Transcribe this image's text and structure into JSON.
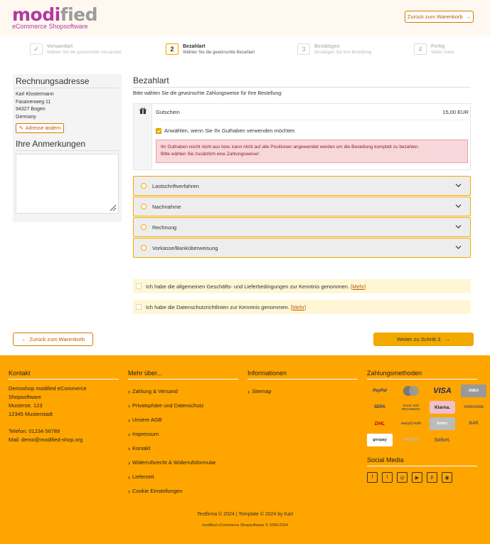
{
  "header": {
    "logo_main_a": "modi",
    "logo_main_b": "fied",
    "logo_sub": "eCommerce Shopsoftware",
    "back_to_cart": "Zurück zum Warenkorb"
  },
  "steps": [
    {
      "num": "",
      "title": "Versandart",
      "desc": "Wählen Sie die gewünschte Versandart"
    },
    {
      "num": "2",
      "title": "Bezahlart",
      "desc": "Wählen Sie die gewünschte Bezahlart"
    },
    {
      "num": "3",
      "title": "Bestätigen",
      "desc": "Bestätigen Sie Ihre Bestellung"
    },
    {
      "num": "4",
      "title": "Fertig",
      "desc": "Vielen Dank"
    }
  ],
  "billing": {
    "title": "Rechnungsadresse",
    "name": "Karl Klostermann",
    "street": "Fasanenweg 11",
    "city": "94327 Bogen",
    "country": "Germany",
    "change_button": "Adresse ändern"
  },
  "notes": {
    "title": "Ihre Anmerkungen",
    "value": ""
  },
  "payment": {
    "title": "Bezahlart",
    "subtitle": "Bitte wählen Sie die gewünschte Zahlungsweise für Ihre Bestellung:",
    "voucher_label": "Gutschein",
    "voucher_amount": "15,00 EUR",
    "voucher_check": "Anwählen, wenn Sie Ihr Guthaben verwenden möchten",
    "alert_line1": "Ihr Guthaben reicht nicht aus bzw. kann nicht auf alle Positionen angewendet werden um die Bestellung komplett zu bezahlen.",
    "alert_line2": "Bitte wählen Sie zusätzlich eine Zahlungsweise!",
    "methods": [
      "Lastschriftverfahren",
      "Nachnahme",
      "Rechnung",
      "Vorkasse/Banküberweisung"
    ]
  },
  "agreements": [
    {
      "text": "Ich habe die allgemeinen Geschäfts- und Lieferbedingungen zur Kenntnis genommen.",
      "more": "[Mehr]"
    },
    {
      "text": "Ich habe die Datenschutzrichtlinien zur Kenntnis genommen.",
      "more": "[Mehr]"
    }
  ],
  "nav": {
    "back": "Zurück zum Warenkorb",
    "next": "Weiter zu Schritt 3"
  },
  "footer": {
    "contact_title": "Kontakt",
    "contact_lines": [
      "Demoshop modified eCommerce",
      "Shopsoftware",
      "Musterstr. 123",
      "12345 Musterstadt",
      "",
      "Telefon: 01234 56789",
      "Mail: demo@modified-shop.org"
    ],
    "more_title": "Mehr über...",
    "more_links": [
      "Zahlung & Versand",
      "Privatsphäre und Datenschutz",
      "Unsere AGB",
      "Impressum",
      "Kontakt",
      "Widerrufsrecht & Widerrufsformular",
      "Lieferzeit",
      "Cookie Einstellungen"
    ],
    "info_title": "Informationen",
    "info_links": [
      "Sitemap"
    ],
    "payment_title": "Zahlungsmethoden",
    "payment_logos": [
      "PayPal",
      "mastercard",
      "VISA",
      "AMEX",
      "SEPA",
      "KAUF AUF RECHNUNG",
      "Klarna.",
      "VORKASSE",
      "DHL",
      "easyCredit",
      "Sofort.",
      "BAR",
      "giropay",
      "PAYONE",
      "Sofort."
    ],
    "social_title": "Social Media",
    "social_icons": [
      "facebook-icon",
      "twitter-icon",
      "instagram-icon",
      "youtube-icon",
      "pinterest-icon",
      "rss-icon"
    ],
    "copyright": "Testfirma © 2024 | Template © 2024 by Karl",
    "copyright2": "modified eCommerce Shopsoftware © 2009-2024"
  },
  "colors": {
    "accent": "#f2a900",
    "footer_bg": "#ffa500",
    "brand": "#b23aa0",
    "alert_bg": "#f8d7da"
  }
}
